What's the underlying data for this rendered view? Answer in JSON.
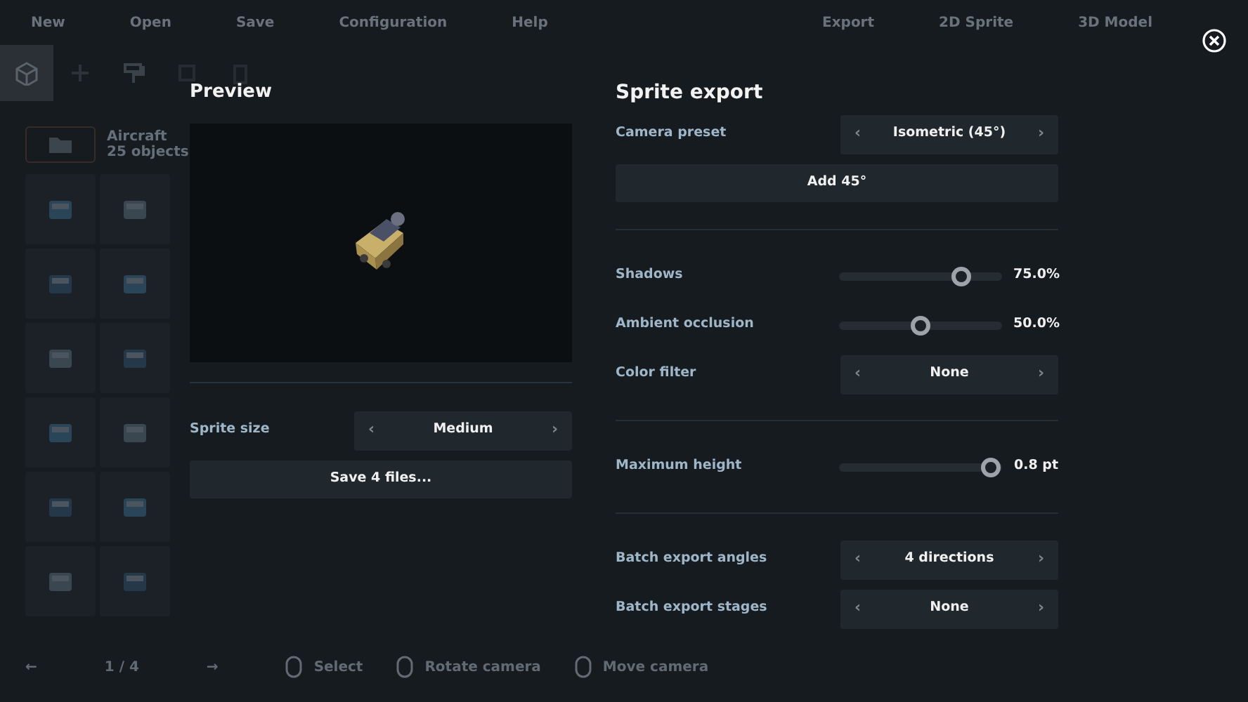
{
  "menu": [
    "New",
    "Open",
    "Save",
    "Configuration",
    "Help"
  ],
  "modes": [
    "Export",
    "2D Sprite",
    "3D Model"
  ],
  "sidebar": {
    "category": "Aircraft",
    "count": "25 objects",
    "page": "1 / 4",
    "prev": "←",
    "next": "→"
  },
  "hints": [
    "Select",
    "Rotate camera",
    "Move camera"
  ],
  "arrows": {
    "prev": "‹",
    "next": "›"
  },
  "preview": {
    "title": "Preview",
    "kind": "picture",
    "sprite_size": {
      "label": "Sprite size",
      "value": "Medium"
    },
    "save_button": "Save 4 files..."
  },
  "export": {
    "title": "Sprite export",
    "settings": [
      {
        "kind": "selector",
        "label": "Camera preset",
        "value": "Isometric (45°)"
      },
      {
        "kind": "button",
        "label": "Add 45°"
      },
      {
        "kind": "divider"
      },
      {
        "kind": "slider",
        "label": "Shadows",
        "level": 0.75,
        "reading": "75.0%"
      },
      {
        "kind": "slider",
        "label": "Ambient occlusion",
        "level": 0.5,
        "reading": "50.0%"
      },
      {
        "kind": "selector",
        "label": "Color filter",
        "value": "None"
      },
      {
        "kind": "divider"
      },
      {
        "kind": "slider",
        "label": "Maximum height",
        "level": 0.93,
        "reading": "0.8 pt"
      },
      {
        "kind": "divider"
      },
      {
        "kind": "selector",
        "label": "Batch export angles",
        "value": "4 directions"
      },
      {
        "kind": "selector",
        "label": "Batch export stages",
        "value": "None"
      }
    ]
  }
}
